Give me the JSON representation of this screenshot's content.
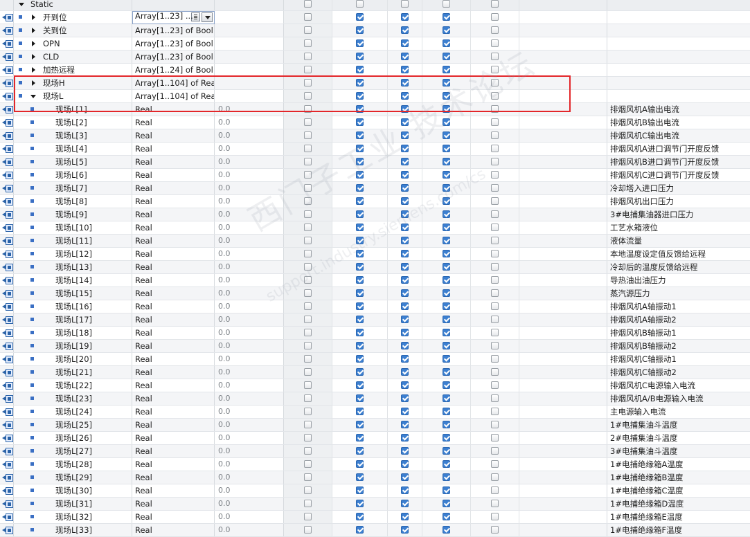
{
  "section": {
    "label": "Static"
  },
  "columns": {
    "default_value_placeholder": "0.0"
  },
  "top_rows": [
    {
      "name": "开到位",
      "type": "Array[1..23] ...",
      "expanded": false,
      "checks": [
        false,
        true,
        true,
        true,
        false
      ],
      "editing": true
    },
    {
      "name": "关到位",
      "type": "Array[1..23] of Bool",
      "expanded": false,
      "checks": [
        false,
        true,
        true,
        true,
        false
      ]
    },
    {
      "name": "OPN",
      "type": "Array[1..23] of Bool",
      "expanded": false,
      "checks": [
        false,
        true,
        true,
        true,
        false
      ]
    },
    {
      "name": "CLD",
      "type": "Array[1..23] of Bool",
      "expanded": false,
      "checks": [
        false,
        true,
        true,
        true,
        false
      ]
    },
    {
      "name": "加热远程",
      "type": "Array[1..24] of Bool",
      "expanded": false,
      "checks": [
        false,
        true,
        true,
        true,
        false
      ]
    },
    {
      "name": "现场H",
      "type": "Array[1..104] of Real",
      "expanded": false,
      "checks": [
        false,
        true,
        true,
        true,
        false
      ]
    },
    {
      "name": "现场L",
      "type": "Array[1..104] of Real",
      "expanded": true,
      "checks": [
        false,
        true,
        true,
        true,
        false
      ]
    }
  ],
  "elements": [
    {
      "name": "现场L[1]",
      "type": "Real",
      "default": "0.0",
      "comment": "排烟风机A输出电流"
    },
    {
      "name": "现场L[2]",
      "type": "Real",
      "default": "0.0",
      "comment": "排烟风机B输出电流"
    },
    {
      "name": "现场L[3]",
      "type": "Real",
      "default": "0.0",
      "comment": "排烟风机C输出电流"
    },
    {
      "name": "现场L[4]",
      "type": "Real",
      "default": "0.0",
      "comment": "排烟风机A进口调节门开度反馈"
    },
    {
      "name": "现场L[5]",
      "type": "Real",
      "default": "0.0",
      "comment": "排烟风机B进口调节门开度反馈"
    },
    {
      "name": "现场L[6]",
      "type": "Real",
      "default": "0.0",
      "comment": "排烟风机C进口调节门开度反馈"
    },
    {
      "name": "现场L[7]",
      "type": "Real",
      "default": "0.0",
      "comment": "冷却塔入进口压力"
    },
    {
      "name": "现场L[8]",
      "type": "Real",
      "default": "0.0",
      "comment": "排烟风机出口压力"
    },
    {
      "name": "现场L[9]",
      "type": "Real",
      "default": "0.0",
      "comment": "3#电捕集油器进口压力"
    },
    {
      "name": "现场L[10]",
      "type": "Real",
      "default": "0.0",
      "comment": "工艺水箱液位"
    },
    {
      "name": "现场L[11]",
      "type": "Real",
      "default": "0.0",
      "comment": "液体流量"
    },
    {
      "name": "现场L[12]",
      "type": "Real",
      "default": "0.0",
      "comment": "本地温度设定值反馈给远程"
    },
    {
      "name": "现场L[13]",
      "type": "Real",
      "default": "0.0",
      "comment": "冷却后的温度反馈给远程"
    },
    {
      "name": "现场L[14]",
      "type": "Real",
      "default": "0.0",
      "comment": "导热油出油压力"
    },
    {
      "name": "现场L[15]",
      "type": "Real",
      "default": "0.0",
      "comment": "蒸汽源压力"
    },
    {
      "name": "现场L[16]",
      "type": "Real",
      "default": "0.0",
      "comment": "排烟风机A轴振动1"
    },
    {
      "name": "现场L[17]",
      "type": "Real",
      "default": "0.0",
      "comment": "排烟风机A轴振动2"
    },
    {
      "name": "现场L[18]",
      "type": "Real",
      "default": "0.0",
      "comment": "排烟风机B轴振动1"
    },
    {
      "name": "现场L[19]",
      "type": "Real",
      "default": "0.0",
      "comment": "排烟风机B轴振动2"
    },
    {
      "name": "现场L[20]",
      "type": "Real",
      "default": "0.0",
      "comment": "排烟风机C轴振动1"
    },
    {
      "name": "现场L[21]",
      "type": "Real",
      "default": "0.0",
      "comment": "排烟风机C轴振动2"
    },
    {
      "name": "现场L[22]",
      "type": "Real",
      "default": "0.0",
      "comment": "排烟风机C电源输入电流"
    },
    {
      "name": "现场L[23]",
      "type": "Real",
      "default": "0.0",
      "comment": "排烟风机A/B电源输入电流"
    },
    {
      "name": "现场L[24]",
      "type": "Real",
      "default": "0.0",
      "comment": "主电源输入电流"
    },
    {
      "name": "现场L[25]",
      "type": "Real",
      "default": "0.0",
      "comment": "1#电捕集油斗温度"
    },
    {
      "name": "现场L[26]",
      "type": "Real",
      "default": "0.0",
      "comment": "2#电捕集油斗温度"
    },
    {
      "name": "现场L[27]",
      "type": "Real",
      "default": "0.0",
      "comment": "3#电捕集油斗温度"
    },
    {
      "name": "现场L[28]",
      "type": "Real",
      "default": "0.0",
      "comment": "1#电捕绝缘箱A温度"
    },
    {
      "name": "现场L[29]",
      "type": "Real",
      "default": "0.0",
      "comment": "1#电捕绝缘箱B温度"
    },
    {
      "name": "现场L[30]",
      "type": "Real",
      "default": "0.0",
      "comment": "1#电捕绝缘箱C温度"
    },
    {
      "name": "现场L[31]",
      "type": "Real",
      "default": "0.0",
      "comment": "1#电捕绝缘箱D温度"
    },
    {
      "name": "现场L[32]",
      "type": "Real",
      "default": "0.0",
      "comment": "1#电捕绝缘箱E温度"
    },
    {
      "name": "现场L[33]",
      "type": "Real",
      "default": "0.0",
      "comment": "1#电捕绝缘箱F温度"
    }
  ],
  "element_checks": [
    false,
    true,
    true,
    true,
    false
  ],
  "watermark": {
    "line1": "西门子工业  技术论坛",
    "line2": "support.industry.siemens.com/cs"
  }
}
